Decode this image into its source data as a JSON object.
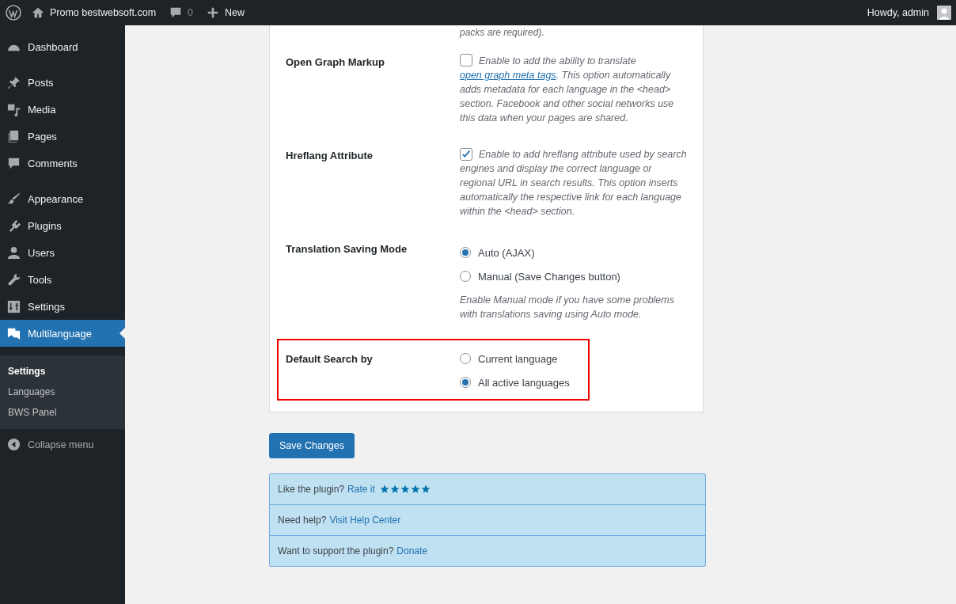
{
  "admin_bar": {
    "site": "Promo bestwebsoft.com",
    "comments": "0",
    "new": "New",
    "greeting": "Howdy, admin"
  },
  "sidebar": {
    "groups": [
      [
        {
          "label": "Dashboard",
          "selected": false
        }
      ],
      [
        {
          "label": "Posts",
          "selected": false
        },
        {
          "label": "Media",
          "selected": false
        },
        {
          "label": "Pages",
          "selected": false
        },
        {
          "label": "Comments",
          "selected": false
        }
      ],
      [
        {
          "label": "Appearance",
          "selected": false
        },
        {
          "label": "Plugins",
          "selected": false
        },
        {
          "label": "Users",
          "selected": false
        },
        {
          "label": "Tools",
          "selected": false
        },
        {
          "label": "Settings",
          "selected": false
        },
        {
          "label": "Multilanguage",
          "selected": true
        }
      ]
    ],
    "submenu": [
      {
        "label": "Settings",
        "selected": true
      },
      {
        "label": "Languages",
        "selected": false
      },
      {
        "label": "BWS Panel",
        "selected": false
      }
    ],
    "collapse": "Collapse menu"
  },
  "settings": {
    "cut_text": "packs are required).",
    "rows": [
      {
        "kind": "checkbox",
        "label": "Open Graph Markup",
        "highlighted": false,
        "checked": false,
        "text_before": "Enable to add the ability to translate ",
        "link": "open graph meta tags",
        "text_after": ". This option automatically adds metadata for each language in the <head> section. Facebook and other social networks use this data when your pages are shared."
      },
      {
        "kind": "checkbox",
        "label": "Hreflang Attribute",
        "highlighted": false,
        "checked": true,
        "text_before": "Enable to add hreflang attribute used by search engines and display the correct language or regional URL in search results. This option inserts automatically the respective link for each language within the <head> section."
      },
      {
        "kind": "radio",
        "label": "Translation Saving Mode",
        "highlighted": false,
        "options": [
          {
            "label": "Auto (AJAX)",
            "selected": true
          },
          {
            "label": "Manual (Save Changes button)",
            "selected": false
          }
        ],
        "note": "Enable Manual mode if you have some problems with translations saving using Auto mode."
      },
      {
        "kind": "radio",
        "label": "Default Search by",
        "highlighted": true,
        "options": [
          {
            "label": "Current language",
            "selected": false
          },
          {
            "label": "All active languages",
            "selected": true
          }
        ]
      }
    ]
  },
  "save_button": "Save Changes",
  "info": [
    {
      "text": "Like the plugin?",
      "link": "Rate it",
      "stars": 5
    },
    {
      "text": "Need help?",
      "link": "Visit Help Center"
    },
    {
      "text": "Want to support the plugin?",
      "link": "Donate"
    }
  ]
}
